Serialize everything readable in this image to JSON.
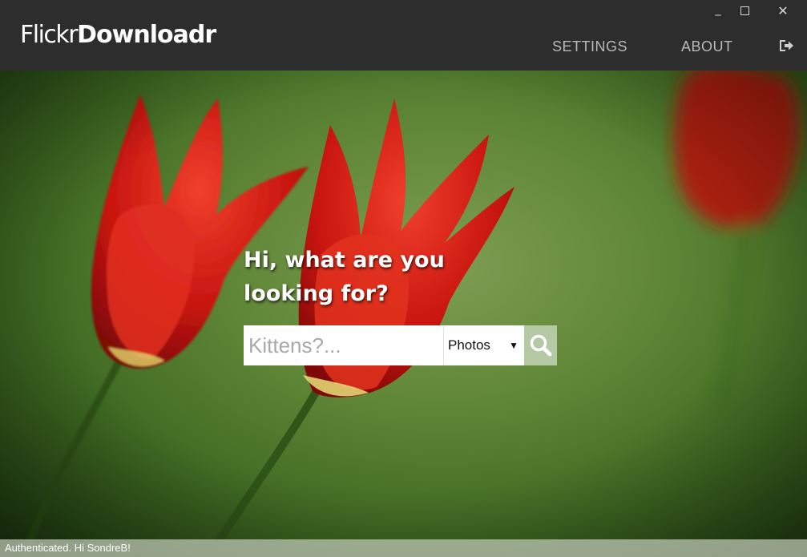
{
  "app": {
    "logo_light": "Flickr",
    "logo_bold": "Downloadr"
  },
  "window_controls": {
    "minimize": "_",
    "close": "✕"
  },
  "nav": {
    "settings_label": "SETTINGS",
    "about_label": "ABOUT"
  },
  "search": {
    "headline_line1": "Hi, what are you",
    "headline_line2": "looking for?",
    "placeholder": "Kittens?...",
    "value": "",
    "type_selected": "Photos",
    "type_arrow": "▼"
  },
  "status": {
    "text": "Authenticated. Hi SondreB!"
  },
  "icons": {
    "logout": "logout-icon",
    "search": "search-icon"
  },
  "colors": {
    "titlebar_bg": "#2d2d2d",
    "nav_text": "#b9b9b9",
    "search_button_bg": "#b5c9a4",
    "flower_red": "#d41f1a",
    "background_green": "#5f8636"
  }
}
